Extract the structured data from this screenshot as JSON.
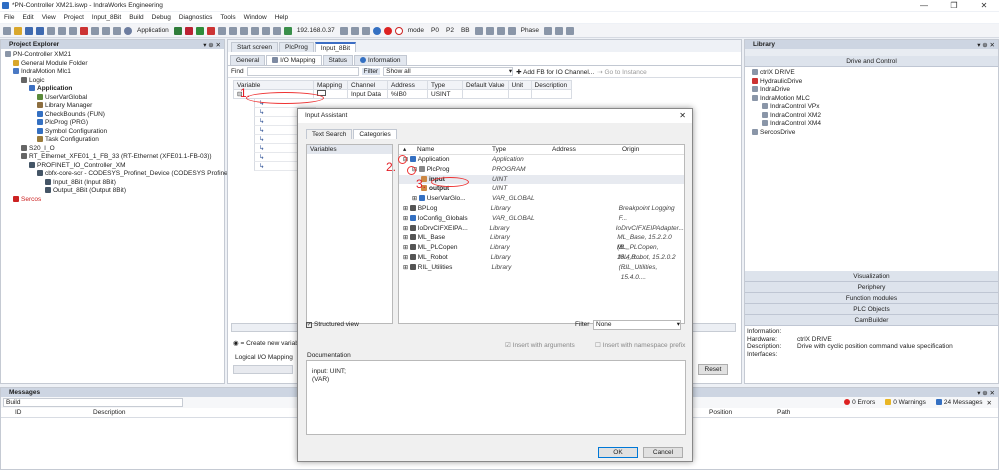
{
  "window": {
    "title": "*PN-Controller XM21.iswp - IndraWorks Engineering",
    "min": "—",
    "max": "❐",
    "close": "✕"
  },
  "menu": [
    "File",
    "Edit",
    "View",
    "Project",
    "Input_8Bit",
    "Build",
    "Debug",
    "Diagnostics",
    "Tools",
    "Window",
    "Help"
  ],
  "toolbar": {
    "application_label": "Application",
    "ip": "192.168.0.37",
    "mode_label": "mode",
    "modes": [
      "P0",
      "P2",
      "BB"
    ],
    "phase_label": "Phase"
  },
  "project_explorer": {
    "title": "Project Explorer",
    "items": [
      {
        "label": "PN-Controller XM21",
        "indent": 0
      },
      {
        "label": "General Module Folder",
        "indent": 1
      },
      {
        "label": "IndraMotion Mlc1",
        "indent": 1
      },
      {
        "label": "Logic",
        "indent": 2
      },
      {
        "label": "Application",
        "indent": 3,
        "bold": true
      },
      {
        "label": "UserVarGlobal",
        "indent": 4
      },
      {
        "label": "Library Manager",
        "indent": 4
      },
      {
        "label": "CheckBounds (FUN)",
        "indent": 4
      },
      {
        "label": "PlcProg (PRG)",
        "indent": 4
      },
      {
        "label": "Symbol Configuration",
        "indent": 4
      },
      {
        "label": "Task Configuration",
        "indent": 4
      },
      {
        "label": "S20_I_O",
        "indent": 2
      },
      {
        "label": "RT_Ethernet_XFE01_1_FB_33 (RT-Ethernet (XFE01.1-FB-03))",
        "indent": 2
      },
      {
        "label": "PROFINET_IO_Controller_XM",
        "indent": 3
      },
      {
        "label": "cbfx-core-scr - CODESYS_Profinet_Device (CODESYS Profinet",
        "indent": 4
      },
      {
        "label": "Input_8Bit (Input 8Bit)",
        "indent": 5
      },
      {
        "label": "Output_8Bit (Output 8Bit)",
        "indent": 5
      },
      {
        "label": "Sercos",
        "indent": 1,
        "red": true
      }
    ]
  },
  "editor": {
    "doc_tabs": [
      "Start screen",
      "PlcProg",
      "Input_8Bit"
    ],
    "sub_tabs": [
      "General",
      "I/O Mapping",
      "Status",
      "Information"
    ],
    "find_label": "Find",
    "filter_label": "Filter",
    "filter_value": "Show all",
    "add_fb": "Add FB for IO Channel...",
    "goto_instance": "Go to Instance",
    "columns": [
      "Variable",
      "Mapping",
      "Channel",
      "Address",
      "Type",
      "Default Value",
      "Unit",
      "Description"
    ],
    "first_row": {
      "channel": "Input Data",
      "address": "%IB0",
      "type": "USINT"
    },
    "create_new": "= Create new variable",
    "logical_mapping": "Logical I/O Mapping",
    "reset": "Reset"
  },
  "dialog": {
    "title": "Input Assistant",
    "tabs": [
      "Text Search",
      "Categories"
    ],
    "categories": [
      "Variables"
    ],
    "columns": [
      "Name",
      "Type",
      "Address",
      "Origin"
    ],
    "rows": [
      {
        "name": "Application",
        "type": "Application",
        "origin": ""
      },
      {
        "name": "PlcProg",
        "type": "PROGRAM",
        "origin": ""
      },
      {
        "name": "input",
        "type": "UINT",
        "origin": ""
      },
      {
        "name": "output",
        "type": "UINT",
        "origin": ""
      },
      {
        "name": "UserVarGlo...",
        "type": "VAR_GLOBAL",
        "origin": ""
      },
      {
        "name": "BPLog",
        "type": "Library",
        "origin": "Breakpoint Logging F..."
      },
      {
        "name": "IoConfig_Globals",
        "type": "VAR_GLOBAL",
        "origin": ""
      },
      {
        "name": "IoDrvCIFXEIPA...",
        "type": "Library",
        "origin": "IoDrvCIFXEIPAdapter..."
      },
      {
        "name": "ML_Base",
        "type": "Library",
        "origin": "ML_Base, 15.2.2.0 (B..."
      },
      {
        "name": "ML_PLCopen",
        "type": "Library",
        "origin": "ML_PLCopen, 15.4.0...."
      },
      {
        "name": "ML_Robot",
        "type": "Library",
        "origin": "ML_Robot, 15.2.0.2 (..."
      },
      {
        "name": "RIL_Utilities",
        "type": "Library",
        "origin": "RIL_Utilities, 15.4.0...."
      }
    ],
    "annotations": [
      "1.",
      "2.",
      "3."
    ],
    "structured_view": "Structured view",
    "filter_label": "Filter",
    "filter_value": "None",
    "insert_args": "Insert with arguments",
    "insert_ns": "Insert with namespace prefix",
    "documentation_label": "Documentation",
    "documentation_text": [
      "input: UINT;",
      "(VAR)"
    ],
    "ok": "OK",
    "cancel": "Cancel"
  },
  "library": {
    "title": "Library",
    "section": "Drive and Control",
    "items": [
      {
        "label": "ctrlX DRIVE",
        "indent": 0
      },
      {
        "label": "HydraulicDrive",
        "indent": 0
      },
      {
        "label": "IndraDrive",
        "indent": 0
      },
      {
        "label": "IndraMotion MLC",
        "indent": 0
      },
      {
        "label": "IndraControl VPx",
        "indent": 1
      },
      {
        "label": "IndraControl XM2",
        "indent": 1
      },
      {
        "label": "IndraControl XM4",
        "indent": 1
      },
      {
        "label": "SercosDrive",
        "indent": 0
      }
    ],
    "sections": [
      "Visualization",
      "Periphery",
      "Function modules",
      "PLC Objects",
      "CamBuilder"
    ],
    "info_label": "Information:",
    "info": [
      {
        "k": "Hardware:",
        "v": "ctrlX DRIVE"
      },
      {
        "k": "Description:",
        "v": "Drive with cyclic position command value specification"
      },
      {
        "k": "Interfaces:",
        "v": ""
      }
    ]
  },
  "messages": {
    "title": "Messages",
    "source": "Build",
    "errors": "0 Errors",
    "warnings": "0 Warnings",
    "msgs": "24 Messages",
    "columns": [
      "ID",
      "Description",
      "Position",
      "Path"
    ]
  }
}
